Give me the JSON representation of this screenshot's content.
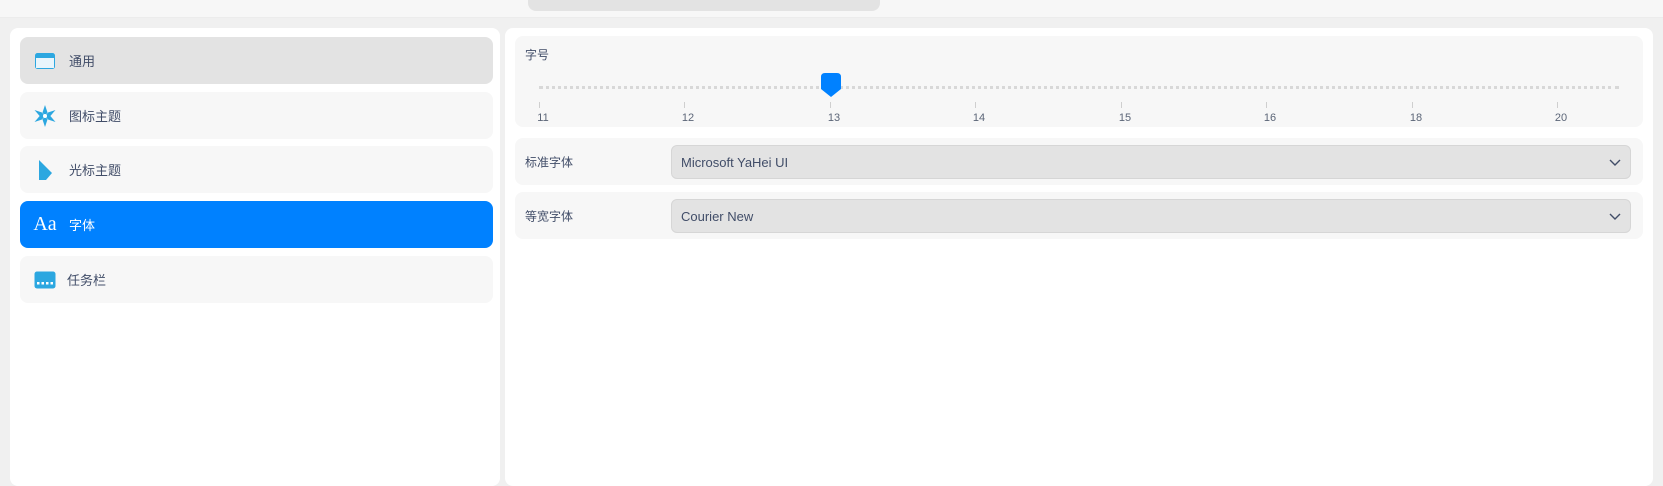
{
  "nav": {
    "items": [
      {
        "label": "通用",
        "icon": "general-window-icon",
        "state": "hover"
      },
      {
        "label": "图标主题",
        "icon": "icon-theme-icon",
        "state": "normal"
      },
      {
        "label": "光标主题",
        "icon": "cursor-theme-icon",
        "state": "normal"
      },
      {
        "label": "字体",
        "icon": "font-icon",
        "icon_text": "Aa",
        "state": "active"
      },
      {
        "label": "任务栏",
        "icon": "taskbar-icon",
        "state": "normal"
      }
    ]
  },
  "font_size": {
    "title": "字号",
    "value": 13,
    "ticks": [
      "11",
      "12",
      "13",
      "14",
      "15",
      "16",
      "18",
      "20"
    ]
  },
  "standard_font": {
    "label": "标准字体",
    "value": "Microsoft YaHei UI"
  },
  "monospace_font": {
    "label": "等宽字体",
    "value": "Courier New"
  },
  "colors": {
    "accent": "#0081ff",
    "icon_blue": "#2ca7e0",
    "panel_bg": "#f7f7f7"
  }
}
